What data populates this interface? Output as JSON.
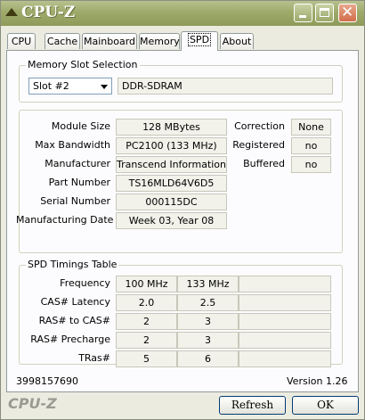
{
  "window": {
    "title": "CPU-Z"
  },
  "tabs": [
    {
      "label": "CPU"
    },
    {
      "label": "Cache"
    },
    {
      "label": "Mainboard"
    },
    {
      "label": "Memory"
    },
    {
      "label": "SPD"
    },
    {
      "label": "About"
    }
  ],
  "memory_slot": {
    "group_title": "Memory Slot Selection",
    "selected_slot": "Slot #2",
    "type": "DDR-SDRAM"
  },
  "module": {
    "rows": [
      {
        "label": "Module Size",
        "value": "128 MBytes"
      },
      {
        "label": "Max Bandwidth",
        "value": "PC2100 (133 MHz)"
      },
      {
        "label": "Manufacturer",
        "value": "Transcend Information"
      },
      {
        "label": "Part Number",
        "value": "TS16MLD64V6D5"
      },
      {
        "label": "Serial Number",
        "value": "000115DC"
      },
      {
        "label": "Manufacturing Date",
        "value": "Week 03, Year 08"
      }
    ],
    "flags": [
      {
        "label": "Correction",
        "value": "None"
      },
      {
        "label": "Registered",
        "value": "no"
      },
      {
        "label": "Buffered",
        "value": "no"
      }
    ]
  },
  "timings": {
    "group_title": "SPD Timings Table",
    "rows": [
      {
        "label": "Frequency",
        "c1": "100 MHz",
        "c2": "133 MHz"
      },
      {
        "label": "CAS# Latency",
        "c1": "2.0",
        "c2": "2.5"
      },
      {
        "label": "RAS# to CAS#",
        "c1": "2",
        "c2": "3"
      },
      {
        "label": "RAS# Precharge",
        "c1": "2",
        "c2": "3"
      },
      {
        "label": "TRas#",
        "c1": "5",
        "c2": "6"
      }
    ]
  },
  "footer": {
    "id_number": "3998157690",
    "version": "Version 1.26",
    "brand": "CPU-Z",
    "refresh_label": "Refresh",
    "ok_label": "OK"
  },
  "colors": {
    "titlebar": "#9eaa6a",
    "panel": "#fcfcfe",
    "field": "#f2f2ea"
  }
}
